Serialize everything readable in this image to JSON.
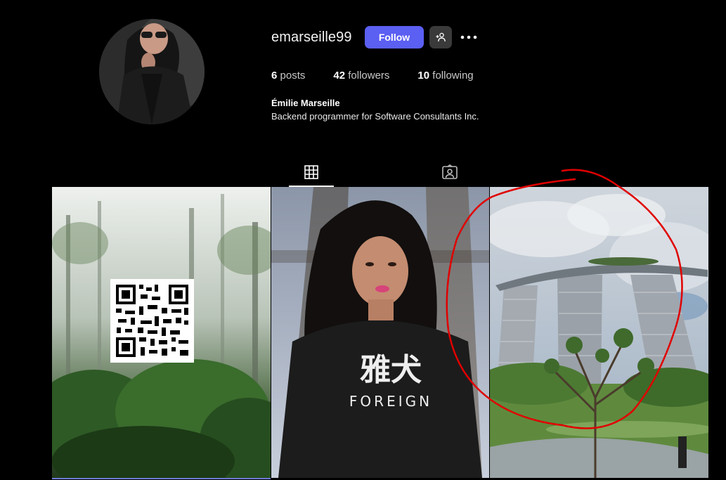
{
  "profile": {
    "username": "emarseille99",
    "full_name": "Émilie Marseille",
    "bio": "Backend programmer for Software Consultants Inc.",
    "avatar_icon": "profile-photo"
  },
  "actions": {
    "follow_label": "Follow",
    "suggest_icon": "add-person-icon",
    "more_icon": "more-options-icon"
  },
  "stats": {
    "posts_count": "6",
    "posts_label": "posts",
    "followers_count": "42",
    "followers_label": "followers",
    "following_count": "10",
    "following_label": "following"
  },
  "tabs": [
    {
      "name": "posts",
      "icon": "grid-icon",
      "active": true
    },
    {
      "name": "tagged",
      "icon": "tagged-person-icon",
      "active": false
    }
  ],
  "posts": [
    {
      "subject": "foggy rainforest with QR code"
    },
    {
      "subject": "woman in black t-shirt",
      "shirt_text_line1": "雅犬",
      "shirt_text_line2": "FOREIGN"
    },
    {
      "subject": "Marina Bay Sands hotel towers"
    }
  ],
  "colors": {
    "background": "#000000",
    "follow_button": "#5b5ff2",
    "secondary_button": "#3a3a3a",
    "annotation": "#e00000"
  }
}
